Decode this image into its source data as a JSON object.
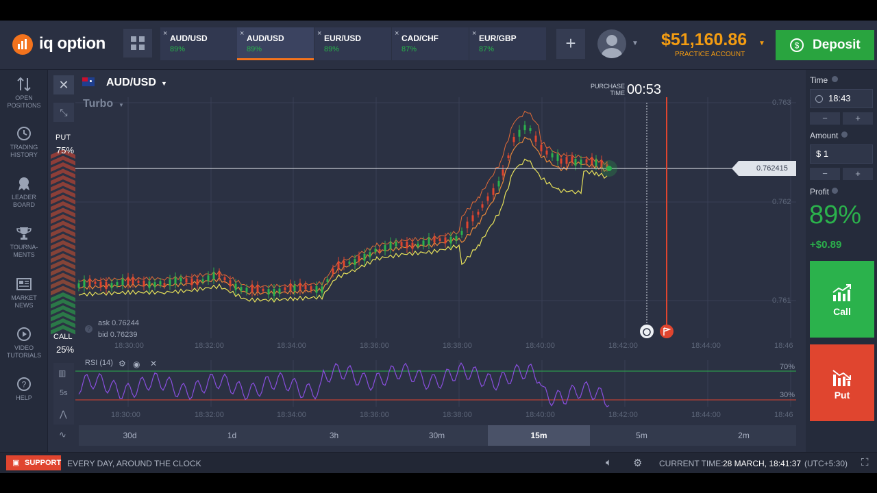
{
  "brand": {
    "name": "iq option"
  },
  "tabs": [
    {
      "pair": "AUD/USD",
      "pct": "89%",
      "active": false
    },
    {
      "pair": "AUD/USD",
      "pct": "89%",
      "active": true
    },
    {
      "pair": "EUR/USD",
      "pct": "89%",
      "active": false
    },
    {
      "pair": "CAD/CHF",
      "pct": "87%",
      "active": false
    },
    {
      "pair": "EUR/GBP",
      "pct": "87%",
      "active": false
    }
  ],
  "tab_close": "×",
  "add_tab": "+",
  "account": {
    "balance": "$51,160.86",
    "type": "PRACTICE ACCOUNT"
  },
  "deposit_label": "Deposit",
  "nav": [
    {
      "line1": "OPEN",
      "line2": "POSITIONS"
    },
    {
      "line1": "TRADING",
      "line2": "HISTORY"
    },
    {
      "line1": "LEADER",
      "line2": "BOARD"
    },
    {
      "line1": "TOURNA-",
      "line2": "MENTS"
    },
    {
      "line1": "MARKET",
      "line2": "NEWS"
    },
    {
      "line1": "VIDEO",
      "line2": "TUTORIALS"
    },
    {
      "line1": "HELP",
      "line2": ""
    }
  ],
  "chart": {
    "asset": "AUD/USD",
    "mode": "Turbo",
    "purchase_label_1": "PURCHASE",
    "purchase_label_2": "TIME",
    "purchase_timer": "00:53",
    "put_label": "PUT",
    "put_pct": "75%",
    "call_label": "CALL",
    "call_pct": "25%",
    "current_price": "0.762415",
    "ask": "ask 0.76244",
    "bid": "bid 0.76239",
    "price_axis": [
      "0.763",
      "0.762",
      "0.761"
    ],
    "time_axis": [
      "18:30:00",
      "18:32:00",
      "18:34:00",
      "18:36:00",
      "18:38:00",
      "18:40:00",
      "18:42:00",
      "18:44:00",
      "18:46"
    ],
    "rsi_label": "RSI (14)",
    "rsi_levels": [
      "70%",
      "30%"
    ],
    "side_tool_label": "5s",
    "timeframes": [
      "30d",
      "1d",
      "3h",
      "30m",
      "15m",
      "5m",
      "2m"
    ],
    "active_timeframe": "15m"
  },
  "panel": {
    "time_label": "Time",
    "time_value": "18:43",
    "amount_label": "Amount",
    "amount_value": "$ 1",
    "minus": "−",
    "plus": "+",
    "profit_label": "Profit",
    "profit_pct": "89%",
    "profit_value": "+$0.89",
    "call_label": "Call",
    "put_label": "Put"
  },
  "footer": {
    "support": "SUPPORT",
    "tagline": "EVERY DAY, AROUND THE CLOCK",
    "current_time_label": "CURRENT TIME:",
    "current_time": "28 MARCH, 18:41:37",
    "tz": "(UTC+5:30)"
  },
  "colors": {
    "call": "#2bb24c",
    "put": "#e0452f",
    "accent": "#f39c12",
    "bg": "#2b3143"
  }
}
